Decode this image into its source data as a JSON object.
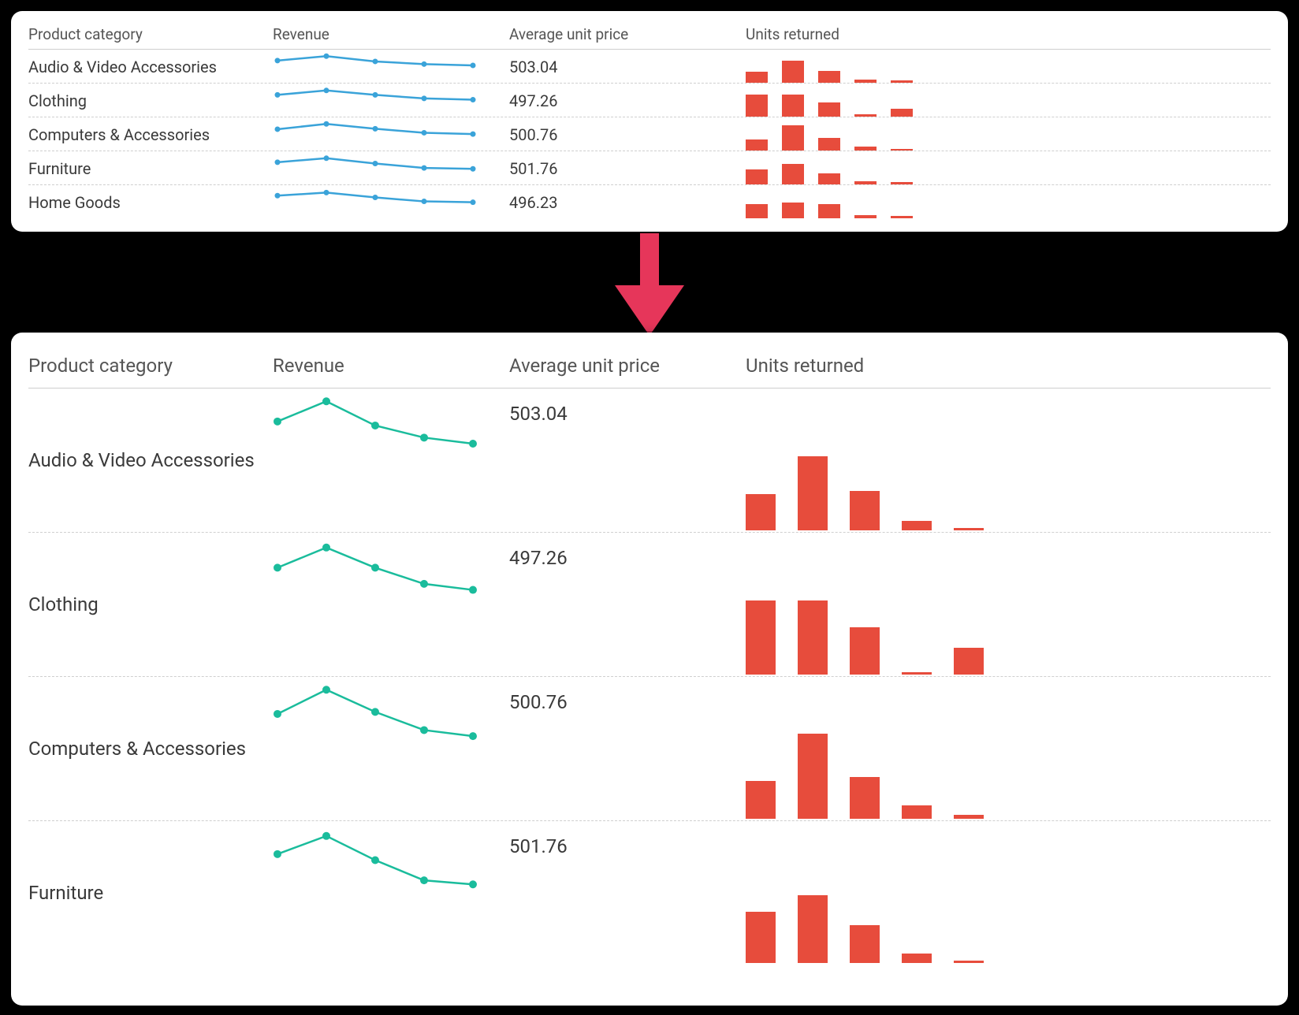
{
  "columns": [
    "Product category",
    "Revenue",
    "Average unit price",
    "Units returned"
  ],
  "colors": {
    "line_top": "#3aa3d9",
    "line_bottom": "#1abc9c",
    "bar": "#e74c3c",
    "arrow": "#e6365a"
  },
  "rows": [
    {
      "category": "Audio & Video Accessories",
      "price": "503.04",
      "revenue": [
        72,
        92,
        68,
        56,
        50
      ],
      "returns": [
        38,
        78,
        42,
        10,
        0
      ]
    },
    {
      "category": "Clothing",
      "price": "497.26",
      "revenue": [
        70,
        90,
        70,
        54,
        48
      ],
      "returns": [
        78,
        78,
        50,
        0,
        28
      ]
    },
    {
      "category": "Computers & Accessories",
      "price": "500.76",
      "revenue": [
        68,
        92,
        70,
        52,
        46
      ],
      "returns": [
        40,
        90,
        44,
        14,
        4
      ]
    },
    {
      "category": "Furniture",
      "price": "501.76",
      "revenue": [
        72,
        90,
        66,
        46,
        42
      ],
      "returns": [
        54,
        72,
        40,
        10,
        0
      ]
    },
    {
      "category": "Home Goods",
      "price": "496.23",
      "revenue": [
        74,
        88,
        66,
        48,
        44
      ],
      "returns": [
        50,
        56,
        50,
        10,
        0
      ]
    }
  ],
  "chart_data": {
    "type": "table",
    "columns": [
      "Product category",
      "Revenue (sparkline, rel 0-100)",
      "Average unit price",
      "Units returned (bar, rel 0-100)"
    ],
    "series": [
      {
        "category": "Audio & Video Accessories",
        "avg_unit_price": 503.04,
        "revenue_trend": [
          72,
          92,
          68,
          56,
          50
        ],
        "units_returned": [
          38,
          78,
          42,
          10,
          0
        ]
      },
      {
        "category": "Clothing",
        "avg_unit_price": 497.26,
        "revenue_trend": [
          70,
          90,
          70,
          54,
          48
        ],
        "units_returned": [
          78,
          78,
          50,
          0,
          28
        ]
      },
      {
        "category": "Computers & Accessories",
        "avg_unit_price": 500.76,
        "revenue_trend": [
          68,
          92,
          70,
          52,
          46
        ],
        "units_returned": [
          40,
          90,
          44,
          14,
          4
        ]
      },
      {
        "category": "Furniture",
        "avg_unit_price": 501.76,
        "revenue_trend": [
          72,
          90,
          66,
          46,
          42
        ],
        "units_returned": [
          54,
          72,
          40,
          10,
          0
        ]
      },
      {
        "category": "Home Goods",
        "avg_unit_price": 496.23,
        "revenue_trend": [
          74,
          88,
          66,
          48,
          44
        ],
        "units_returned": [
          50,
          56,
          50,
          10,
          0
        ]
      }
    ],
    "note": "Trend/return values are relative heights (0-100) read from unlabeled sparklines."
  }
}
